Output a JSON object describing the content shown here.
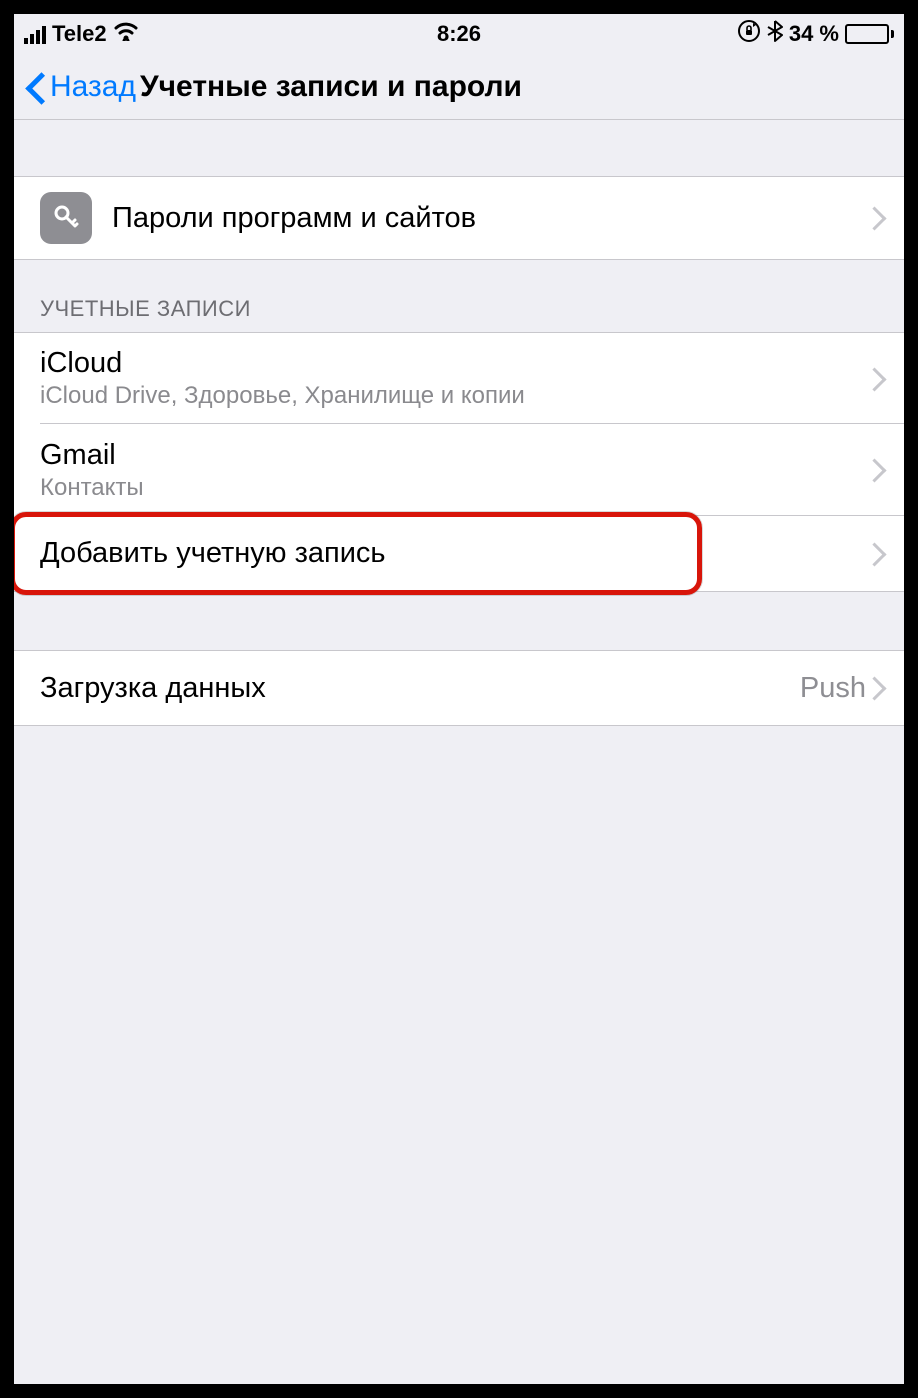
{
  "status": {
    "carrier": "Tele2",
    "time": "8:26",
    "battery_text": "34 %"
  },
  "nav": {
    "back_label": "Назад",
    "title": "Учетные записи и пароли"
  },
  "passwords_row": {
    "title": "Пароли программ и сайтов"
  },
  "accounts": {
    "header": "УЧЕТНЫЕ ЗАПИСИ",
    "items": [
      {
        "title": "iCloud",
        "subtitle": "iCloud Drive, Здоровье, Хранилище и копии"
      },
      {
        "title": "Gmail",
        "subtitle": "Контакты"
      }
    ],
    "add_label": "Добавить учетную запись"
  },
  "fetch_row": {
    "title": "Загрузка данных",
    "value": "Push"
  }
}
